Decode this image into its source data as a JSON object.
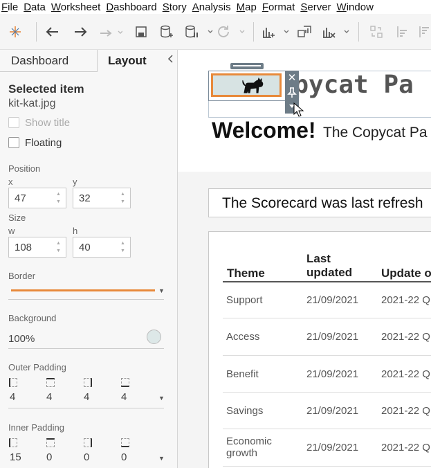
{
  "menu": [
    "File",
    "Data",
    "Worksheet",
    "Dashboard",
    "Story",
    "Analysis",
    "Map",
    "Format",
    "Server",
    "Window"
  ],
  "toolbar_icons": [
    "tableau-logo-icon",
    "undo-icon",
    "redo-icon",
    "replay-icon",
    "save-icon",
    "new-datasource-icon",
    "pause-icon",
    "refresh-icon",
    "new-sheet-icon",
    "duplicate-icon",
    "clear-icon",
    "swap-icon",
    "sort-icon"
  ],
  "tabs": {
    "dashboard": "Dashboard",
    "layout": "Layout"
  },
  "selected": {
    "heading": "Selected item",
    "file": "kit-kat.jpg",
    "show_title": "Show title",
    "floating": "Floating"
  },
  "position": {
    "label": "Position",
    "x_label": "x",
    "x": "47",
    "y_label": "y",
    "y": "32"
  },
  "size": {
    "label": "Size",
    "w_label": "w",
    "w": "108",
    "h_label": "h",
    "h": "40"
  },
  "border": {
    "label": "Border",
    "color": "#e8893a"
  },
  "background": {
    "label": "Background",
    "value": "100%",
    "color": "#dde8e8"
  },
  "outer_padding": {
    "label": "Outer Padding",
    "values": [
      "4",
      "4",
      "4",
      "4"
    ]
  },
  "inner_padding": {
    "label": "Inner Padding",
    "values": [
      "15",
      "0",
      "0",
      "0"
    ]
  },
  "dashboard": {
    "title": "Copycat Pa",
    "welcome": "Welcome!",
    "welcome_sub": "The Copycat Pa",
    "refresh": "The Scorecard was last refresh",
    "table": {
      "headers": [
        "Theme",
        "Last updated",
        "Update o"
      ],
      "rows": [
        [
          "Support",
          "21/09/2021",
          "2021-22 Q"
        ],
        [
          "Access",
          "21/09/2021",
          "2021-22 Q"
        ],
        [
          "Benefit",
          "21/09/2021",
          "2021-22 Q"
        ],
        [
          "Savings",
          "21/09/2021",
          "2021-22 Q"
        ],
        [
          "Economic growth",
          "21/09/2021",
          "2021-22 Q"
        ]
      ]
    }
  }
}
